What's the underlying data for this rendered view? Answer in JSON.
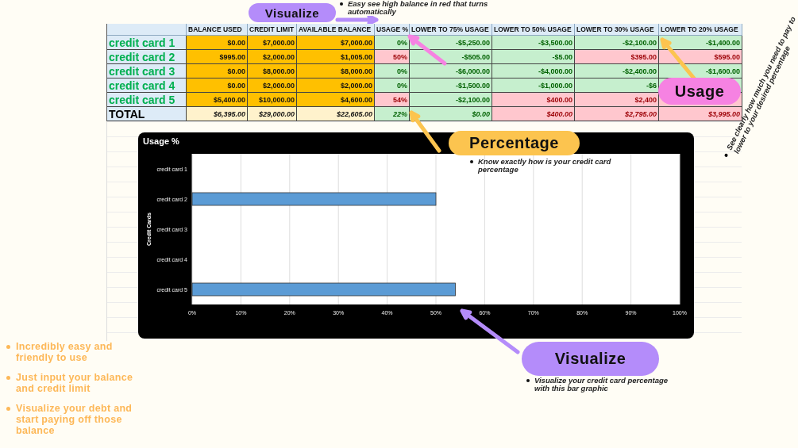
{
  "sheet": {
    "columns": [
      "BALANCE USED",
      "CREDIT LIMIT",
      "AVAILABLE BALANCE",
      "USAGE %",
      "LOWER TO 75% USAGE",
      "LOWER TO 50% USAGE",
      "LOWER TO 30% USAGE",
      "LOWER TO 20% USAGE"
    ],
    "rows": [
      {
        "kind": "card",
        "name": "credit card 1",
        "cells": [
          {
            "text": "$0.00",
            "kind": "input"
          },
          {
            "text": "$7,000.00",
            "kind": "input"
          },
          {
            "text": "$7,000.00",
            "kind": "input"
          },
          {
            "text": "0%",
            "kind": "good"
          },
          {
            "text": "-$5,250.00",
            "kind": "good"
          },
          {
            "text": "-$3,500.00",
            "kind": "good"
          },
          {
            "text": "-$2,100.00",
            "kind": "good"
          },
          {
            "text": "-$1,400.00",
            "kind": "good"
          }
        ]
      },
      {
        "kind": "card",
        "name": "credit card 2",
        "cells": [
          {
            "text": "$995.00",
            "kind": "input"
          },
          {
            "text": "$2,000.00",
            "kind": "input"
          },
          {
            "text": "$1,005.00",
            "kind": "input"
          },
          {
            "text": "50%",
            "kind": "bad"
          },
          {
            "text": "-$505.00",
            "kind": "good"
          },
          {
            "text": "-$5.00",
            "kind": "good"
          },
          {
            "text": "$395.00",
            "kind": "bad"
          },
          {
            "text": "$595.00",
            "kind": "bad"
          }
        ]
      },
      {
        "kind": "card",
        "name": "credit card 3",
        "cells": [
          {
            "text": "$0.00",
            "kind": "input"
          },
          {
            "text": "$8,000.00",
            "kind": "input"
          },
          {
            "text": "$8,000.00",
            "kind": "input"
          },
          {
            "text": "0%",
            "kind": "good"
          },
          {
            "text": "-$6,000.00",
            "kind": "good"
          },
          {
            "text": "-$4,000.00",
            "kind": "good"
          },
          {
            "text": "-$2,400.00",
            "kind": "good"
          },
          {
            "text": "-$1,600.00",
            "kind": "good"
          }
        ]
      },
      {
        "kind": "card",
        "name": "credit card 4",
        "cells": [
          {
            "text": "$0.00",
            "kind": "input"
          },
          {
            "text": "$2,000.00",
            "kind": "input"
          },
          {
            "text": "$2,000.00",
            "kind": "input"
          },
          {
            "text": "0%",
            "kind": "good"
          },
          {
            "text": "-$1,500.00",
            "kind": "good"
          },
          {
            "text": "-$1,000.00",
            "kind": "good"
          },
          {
            "text": "-$6",
            "kind": "good"
          },
          {
            "kind": "good"
          }
        ]
      },
      {
        "kind": "card",
        "name": "credit card 5",
        "cells": [
          {
            "text": "$5,400.00",
            "kind": "input"
          },
          {
            "text": "$10,000.00",
            "kind": "input"
          },
          {
            "text": "$4,600.00",
            "kind": "input"
          },
          {
            "text": "54%",
            "kind": "bad"
          },
          {
            "text": "-$2,100.00",
            "kind": "good"
          },
          {
            "text": "$400.00",
            "kind": "bad"
          },
          {
            "text": "$2,400",
            "kind": "bad"
          },
          {
            "kind": "bad"
          }
        ]
      },
      {
        "kind": "total",
        "name": "TOTAL",
        "cells": [
          {
            "text": "$6,395.00",
            "kind": "total"
          },
          {
            "text": "$29,000.00",
            "kind": "total"
          },
          {
            "text": "$22,605.00",
            "kind": "total"
          },
          {
            "text": "22%",
            "kind": "good"
          },
          {
            "text": "$0.00",
            "kind": "good"
          },
          {
            "text": "$400.00",
            "kind": "bad"
          },
          {
            "text": "$2,795.00",
            "kind": "bad"
          },
          {
            "text": "$3,995.00",
            "kind": "bad"
          }
        ]
      }
    ]
  },
  "chart": {
    "chart_data": {
      "type": "bar",
      "orientation": "horizontal",
      "title": "Usage %",
      "ylabel": "Credit Cards",
      "categories": [
        "credit card 1",
        "credit card 2",
        "credit card 3",
        "credit card 4",
        "credit card 5"
      ],
      "values": [
        0,
        50,
        0,
        0,
        54
      ],
      "xlim": [
        0,
        100
      ],
      "grid": true,
      "xticks": [
        {
          "value": 0,
          "label": "0%"
        },
        {
          "value": 10,
          "label": "10%"
        },
        {
          "value": 20,
          "label": "20%"
        },
        {
          "value": 30,
          "label": "30%"
        },
        {
          "value": 40,
          "label": "40%"
        },
        {
          "value": 50,
          "label": "50%"
        },
        {
          "value": 60,
          "label": "60%"
        },
        {
          "value": 70,
          "label": "70%"
        },
        {
          "value": 80,
          "label": "80%"
        },
        {
          "value": 90,
          "label": "90%"
        },
        {
          "value": 100,
          "label": "100%"
        }
      ]
    }
  },
  "callouts": [
    {
      "label": "Visualize",
      "color": "#b48cfa",
      "note": "Easy see high balance in red that turns automatically"
    },
    {
      "label": "Usage",
      "color": "#f682e2",
      "note": "See clearly how much you need to pay to lower to your desired percentage"
    },
    {
      "label": "Percentage",
      "color": "#fcc44f",
      "note": "Know exactly how is your credit card percentage"
    },
    {
      "label": "Visualize",
      "color": "#b48cfa",
      "note": "Visualize your credit card percentage with this bar graphic"
    }
  ],
  "features": [
    "Incredibly easy and friendly to use",
    "Just input your balance and credit limit",
    "Visualize your debt and start paying off those balance"
  ]
}
